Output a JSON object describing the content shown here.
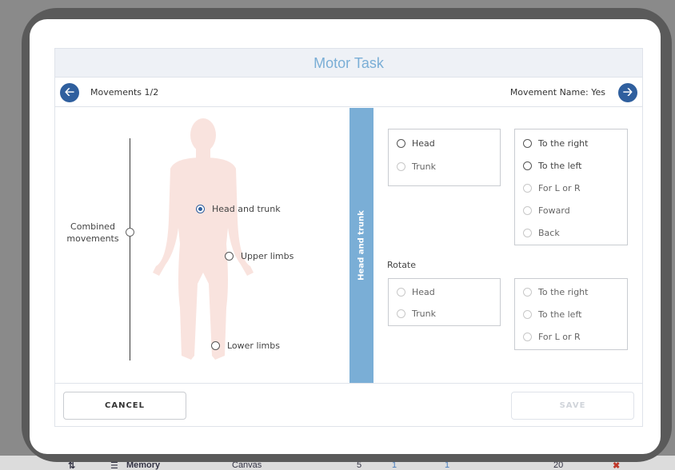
{
  "app": {
    "title": "Motor Task"
  },
  "nav": {
    "left_label": "Movements 1/2",
    "right_label": "Movement Name: Yes",
    "prev_icon": "arrow-left-icon",
    "next_icon": "arrow-right-icon"
  },
  "body_map": {
    "combined_label_line1": "Combined",
    "combined_label_line2": "movements",
    "options": [
      {
        "label": "Head and trunk",
        "selected": true
      },
      {
        "label": "Upper limbs",
        "selected": false
      },
      {
        "label": "Lower limbs",
        "selected": false
      }
    ],
    "silhouette_color": "#f9e3de"
  },
  "side_tab": {
    "label": "Head and trunk",
    "color": "#7aaed6"
  },
  "group1": {
    "parts": [
      {
        "label": "Head",
        "enabled": true
      },
      {
        "label": "Trunk",
        "enabled": false
      }
    ],
    "directions": [
      {
        "label": "To the right",
        "enabled": true
      },
      {
        "label": "To the left",
        "enabled": true
      },
      {
        "label": "For L or R",
        "enabled": false
      },
      {
        "label": "Foward",
        "enabled": false
      },
      {
        "label": "Back",
        "enabled": false
      }
    ]
  },
  "group2": {
    "title": "Rotate",
    "parts": [
      {
        "label": "Head",
        "enabled": false
      },
      {
        "label": "Trunk",
        "enabled": false
      }
    ],
    "directions": [
      {
        "label": "To the right",
        "enabled": false
      },
      {
        "label": "To the left",
        "enabled": false
      },
      {
        "label": "For L or R",
        "enabled": false
      }
    ]
  },
  "footer": {
    "cancel_label": "CANCEL",
    "save_label": "SAVE"
  },
  "background_bar": {
    "memory_label": "Memory",
    "canvas_label": "Canvas",
    "value_a": "5",
    "value_b": "1",
    "value_c": "1",
    "value_d": "20"
  },
  "colors": {
    "accent": "#2f5f9e",
    "title": "#7aaed6",
    "disabled": "#d0d4da"
  }
}
